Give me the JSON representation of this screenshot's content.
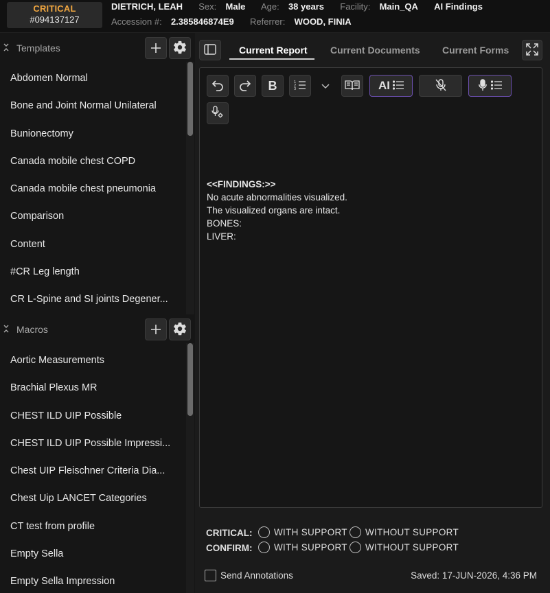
{
  "header": {
    "critical_label": "CRITICAL",
    "order_number": "#094137127",
    "patient_name": "DIETRICH, LEAH",
    "sex_label": "Sex:",
    "sex": "Male",
    "age_label": "Age:",
    "age": "38 years",
    "facility_label": "Facility:",
    "facility": "Main_QA",
    "ai_findings": "AI Findings",
    "accession_label": "Accession #:",
    "accession": "2.385846874E9",
    "referrer_label": "Referrer:",
    "referrer": "WOOD, FINIA"
  },
  "templates": {
    "title": "Templates",
    "items": [
      "Abdomen Normal",
      "Bone and Joint Normal Unilateral",
      "Bunionectomy",
      "Canada mobile chest COPD",
      "Canada mobile chest pneumonia",
      "Comparison",
      "Content",
      "#CR Leg length",
      "CR L-Spine and SI joints Degener..."
    ]
  },
  "macros": {
    "title": "Macros",
    "items": [
      "Aortic Measurements",
      "Brachial Plexus MR",
      "CHEST ILD UIP Possible",
      "CHEST ILD UIP Possible Impressi...",
      "Chest UIP Fleischner Criteria Dia...",
      "Chest Uip LANCET Categories",
      "CT test from profile",
      "Empty Sella",
      "Empty Sella Impression"
    ]
  },
  "tabs": {
    "current_report": "Current Report",
    "current_documents": "Current Documents",
    "current_forms": "Current Forms"
  },
  "toolbar": {
    "bold": "B",
    "ai": "AI"
  },
  "report": {
    "lines": [
      "<<FINDINGS:>>",
      "No acute abnormalities visualized.",
      "The visualized organs are intact.",
      "BONES:",
      "LIVER:"
    ]
  },
  "critical_confirm": {
    "critical_label": "CRITICAL:",
    "confirm_label": "CONFIRM:",
    "with_support": "WITH SUPPORT",
    "without_support": "WITHOUT SUPPORT"
  },
  "footer": {
    "send_annotations": "Send Annotations",
    "saved": "Saved: 17-JUN-2026, 4:36 PM"
  }
}
